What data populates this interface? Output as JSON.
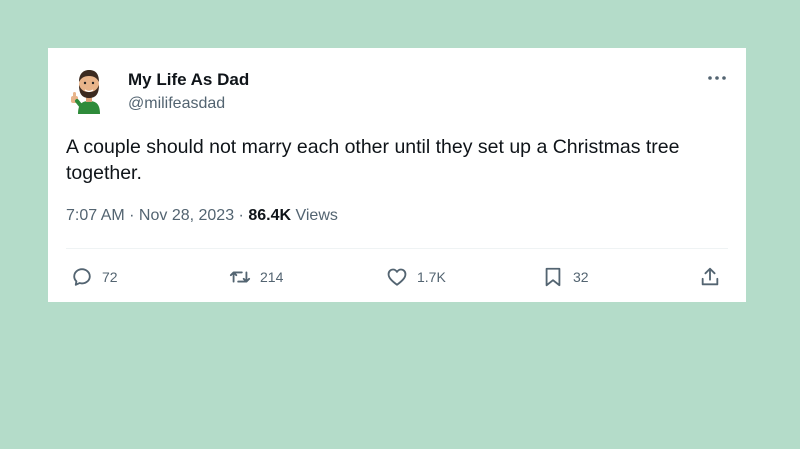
{
  "colors": {
    "background": "#b4dcc9",
    "card": "#ffffff",
    "text_primary": "#0f1419",
    "text_secondary": "#536471",
    "icon": "#536471"
  },
  "tweet": {
    "author": {
      "display_name": "My Life As Dad",
      "handle": "@milifeasdad",
      "avatar": "bearded-dad-avatar-icon"
    },
    "more_icon": "more-dots-icon",
    "text": "A couple should not marry each other until they set up a Christmas tree together.",
    "time": "7:07 AM",
    "separator_1": " · ",
    "date": "Nov 28, 2023",
    "separator_2": " · ",
    "views_count": "86.4K",
    "views_label": " Views",
    "actions": {
      "reply": {
        "icon": "reply-icon",
        "count": "72"
      },
      "retweet": {
        "icon": "retweet-icon",
        "count": "214"
      },
      "like": {
        "icon": "heart-icon",
        "count": "1.7K"
      },
      "bookmark": {
        "icon": "bookmark-icon",
        "count": "32"
      },
      "share": {
        "icon": "share-icon"
      }
    }
  }
}
